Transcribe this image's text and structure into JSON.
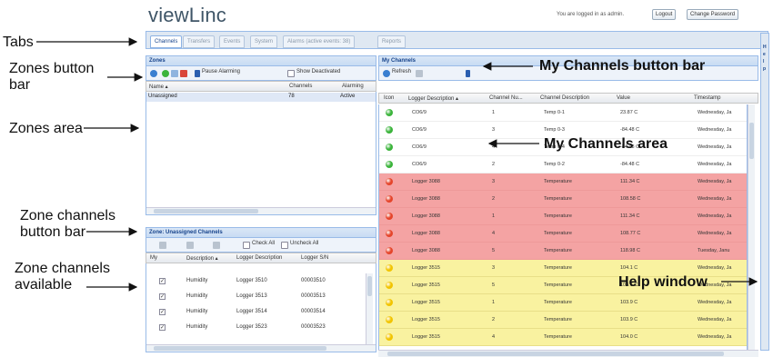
{
  "app": {
    "title": "viewLinc",
    "login_text": "You are logged in as admin.",
    "logout_label": "Logout",
    "change_password_label": "Change Password"
  },
  "tabs": [
    {
      "label": "Channels",
      "active": true
    },
    {
      "label": "Transfers",
      "active": false
    },
    {
      "label": "Events",
      "active": false
    },
    {
      "label": "System",
      "active": false
    },
    {
      "label": "Alarms (active events: 38)",
      "active": false
    },
    {
      "label": "Reports",
      "active": false
    }
  ],
  "zones": {
    "header": "Zones",
    "pause_alarming_label": "Pause Alarming",
    "show_deactivated_label": "Show Deactivated",
    "columns": [
      "Name ▴",
      "Channels",
      "Alarming"
    ],
    "rows": [
      {
        "name": "Unassigned",
        "channels": "78",
        "alarming": "Active"
      }
    ]
  },
  "zone_channels": {
    "header": "Zone: Unassigned Channels",
    "check_all_label": "Check All",
    "uncheck_all_label": "Uncheck All",
    "columns": [
      "My",
      "Description ▴",
      "Logger Description",
      "Logger S/N"
    ],
    "rows": [
      {
        "checked": true,
        "description": "Humidity",
        "logger": "Logger 3510",
        "sn": "00003510"
      },
      {
        "checked": true,
        "description": "Humidity",
        "logger": "Logger 3513",
        "sn": "00003513"
      },
      {
        "checked": true,
        "description": "Humidity",
        "logger": "Logger 3514",
        "sn": "00003514"
      },
      {
        "checked": true,
        "description": "Humidity",
        "logger": "Logger 3523",
        "sn": "00003523"
      }
    ]
  },
  "my_channels": {
    "header": "My Channels",
    "refresh_label": "Refresh",
    "columns": [
      "Icon",
      "Logger Description ▴",
      "Channel Nu...",
      "Channel Description",
      "Value",
      "Timestamp"
    ],
    "rows": [
      {
        "status": "green",
        "logger": "CO6/9",
        "ch": "1",
        "desc": "Temp 0-1",
        "value": "23.87 C",
        "ts": "Wednesday, Ja"
      },
      {
        "status": "green",
        "logger": "CO6/9",
        "ch": "3",
        "desc": "Temp 0-3",
        "value": "-84.48 C",
        "ts": "Wednesday, Ja"
      },
      {
        "status": "green",
        "logger": "CO6/9",
        "ch": "4",
        "desc": "Temp 0-4",
        "value": "-84.48 C",
        "ts": "Wednesday, Ja"
      },
      {
        "status": "green",
        "logger": "CO6/9",
        "ch": "2",
        "desc": "Temp 0-2",
        "value": "-84.48 C",
        "ts": "Wednesday, Ja"
      },
      {
        "status": "red",
        "logger": "Logger 3088",
        "ch": "3",
        "desc": "Temperature",
        "value": "111.34 C",
        "ts": "Wednesday, Ja"
      },
      {
        "status": "red",
        "logger": "Logger 3088",
        "ch": "2",
        "desc": "Temperature",
        "value": "108.58 C",
        "ts": "Wednesday, Ja"
      },
      {
        "status": "red",
        "logger": "Logger 3088",
        "ch": "1",
        "desc": "Temperature",
        "value": "111.34 C",
        "ts": "Wednesday, Ja"
      },
      {
        "status": "red",
        "logger": "Logger 3088",
        "ch": "4",
        "desc": "Temperature",
        "value": "108.77 C",
        "ts": "Wednesday, Ja"
      },
      {
        "status": "red",
        "logger": "Logger 3088",
        "ch": "5",
        "desc": "Temperature",
        "value": "118.98 C",
        "ts": "Tuesday, Janu"
      },
      {
        "status": "yellow",
        "logger": "Logger 3515",
        "ch": "3",
        "desc": "Temperature",
        "value": "104.1 C",
        "ts": "Wednesday, Ja"
      },
      {
        "status": "yellow",
        "logger": "Logger 3515",
        "ch": "5",
        "desc": "Temperature",
        "value": "103.6 C",
        "ts": "Wednesday, Ja"
      },
      {
        "status": "yellow",
        "logger": "Logger 3515",
        "ch": "1",
        "desc": "Temperature",
        "value": "103.9 C",
        "ts": "Wednesday, Ja"
      },
      {
        "status": "yellow",
        "logger": "Logger 3515",
        "ch": "2",
        "desc": "Temperature",
        "value": "103.9 C",
        "ts": "Wednesday, Ja"
      },
      {
        "status": "yellow",
        "logger": "Logger 3515",
        "ch": "4",
        "desc": "Temperature",
        "value": "104.0 C",
        "ts": "Wednesday, Ja"
      }
    ]
  },
  "help_strip": {
    "letters": [
      "H",
      "e",
      "l",
      "p"
    ]
  },
  "annotations": {
    "tabs": "Tabs",
    "zones_button_bar": "Zones button\nbar",
    "zones_area": "Zones area",
    "zone_channels_button_bar": "Zone channels\nbutton bar",
    "zone_channels_available": "Zone channels\navailable",
    "my_channels_button_bar": "My Channels button bar",
    "my_channels_area": "My Channels area",
    "help_window": "Help window"
  },
  "colors": {
    "status_green": "#3cb43c",
    "status_red": "#e5452b",
    "status_yellow": "#f2c400",
    "row_red": "#f4a3a3",
    "row_yellow": "#f9f2a0"
  }
}
